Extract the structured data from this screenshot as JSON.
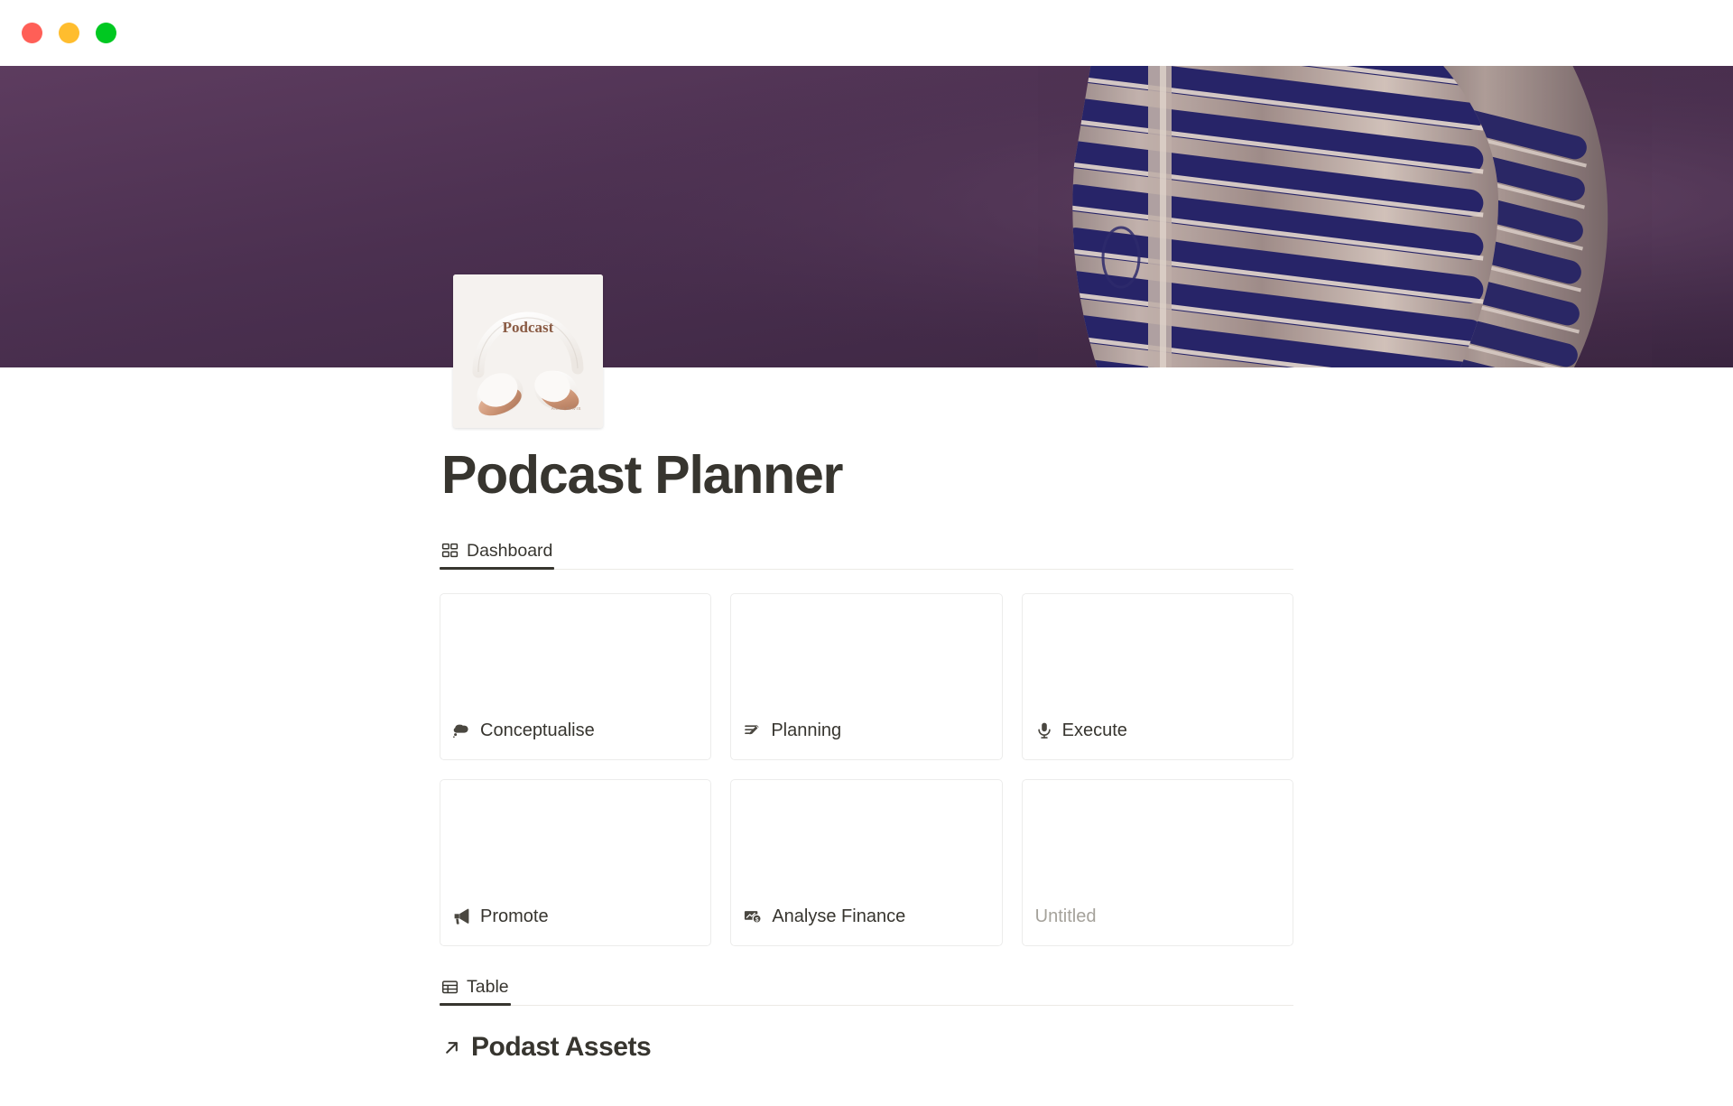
{
  "window": {
    "traffic_lights": [
      {
        "name": "close",
        "color": "#ff5f57"
      },
      {
        "name": "minimize",
        "color": "#ffbd2e"
      },
      {
        "name": "maximize",
        "color": "#00c821"
      }
    ]
  },
  "cover": {
    "description": "vintage chrome microphone on purple background",
    "background_color": "#4d3050",
    "gradient_from": "#5a3a5c",
    "gradient_to": "#3c2740",
    "mic_metal_color": "#b9a9a4",
    "mic_mesh_color": "#2a2a72"
  },
  "page_icon": {
    "name": "podcast-headphones-icon",
    "caption": "Podcast",
    "credit": "ANNA DAVIS",
    "background_color": "#f4f1ee",
    "accent_color": "#c28b6e"
  },
  "page": {
    "title": "Podcast Planner"
  },
  "dashboard_tabs": [
    {
      "label": "Dashboard",
      "icon": "gallery-grid-icon",
      "active": true
    }
  ],
  "cards": [
    {
      "title": "Conceptualise",
      "icon": "thought-bubble-icon",
      "placeholder": false
    },
    {
      "title": "Planning",
      "icon": "note-pencil-icon",
      "placeholder": false
    },
    {
      "title": "Execute",
      "icon": "microphone-icon",
      "placeholder": false
    },
    {
      "title": "Promote",
      "icon": "megaphone-icon",
      "placeholder": false
    },
    {
      "title": "Analyse Finance",
      "icon": "money-bill-icon",
      "placeholder": false
    },
    {
      "title": "Untitled",
      "icon": "",
      "placeholder": true
    }
  ],
  "table_tabs": [
    {
      "label": "Table",
      "icon": "table-grid-icon",
      "active": true
    }
  ],
  "linked_database": {
    "icon": "arrow-up-right-icon",
    "title": "Podast Assets"
  },
  "colors": {
    "text_primary": "#37352f",
    "text_placeholder": "#a5a29b",
    "card_border": "#ececeb",
    "tab_divider": "#eceae5",
    "tab_indicator": "#37352f",
    "page_background": "#ffffff"
  }
}
